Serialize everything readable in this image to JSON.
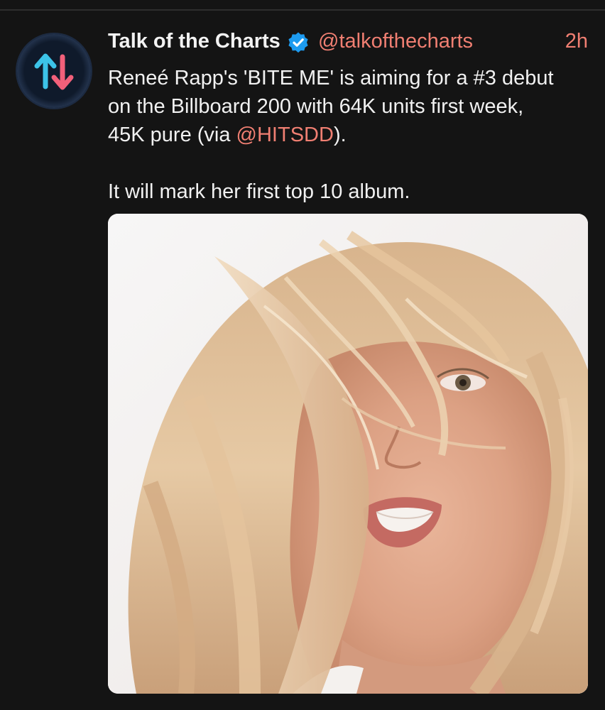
{
  "tweet": {
    "display_name": "Talk of the Charts",
    "handle": "@talkofthecharts",
    "timestamp": "2h",
    "text_line1": "Reneé Rapp's 'BITE ME' is aiming for a #3 debut",
    "text_line2": "on the Billboard 200 with 64K units first week,",
    "text_line3_before": "45K pure (via ",
    "text_line3_mention": "@HITSDD",
    "text_line3_after": ").",
    "text_line4": "It will mark her first top 10 album."
  },
  "icons": {
    "avatar": "up-down-arrows-logo",
    "verified": "verified-badge-icon"
  },
  "colors": {
    "background": "#141414",
    "accent": "#f07f72",
    "verified_blue": "#1d9bf0",
    "arrow_up": "#3cc3e8",
    "arrow_down": "#f2607a"
  }
}
